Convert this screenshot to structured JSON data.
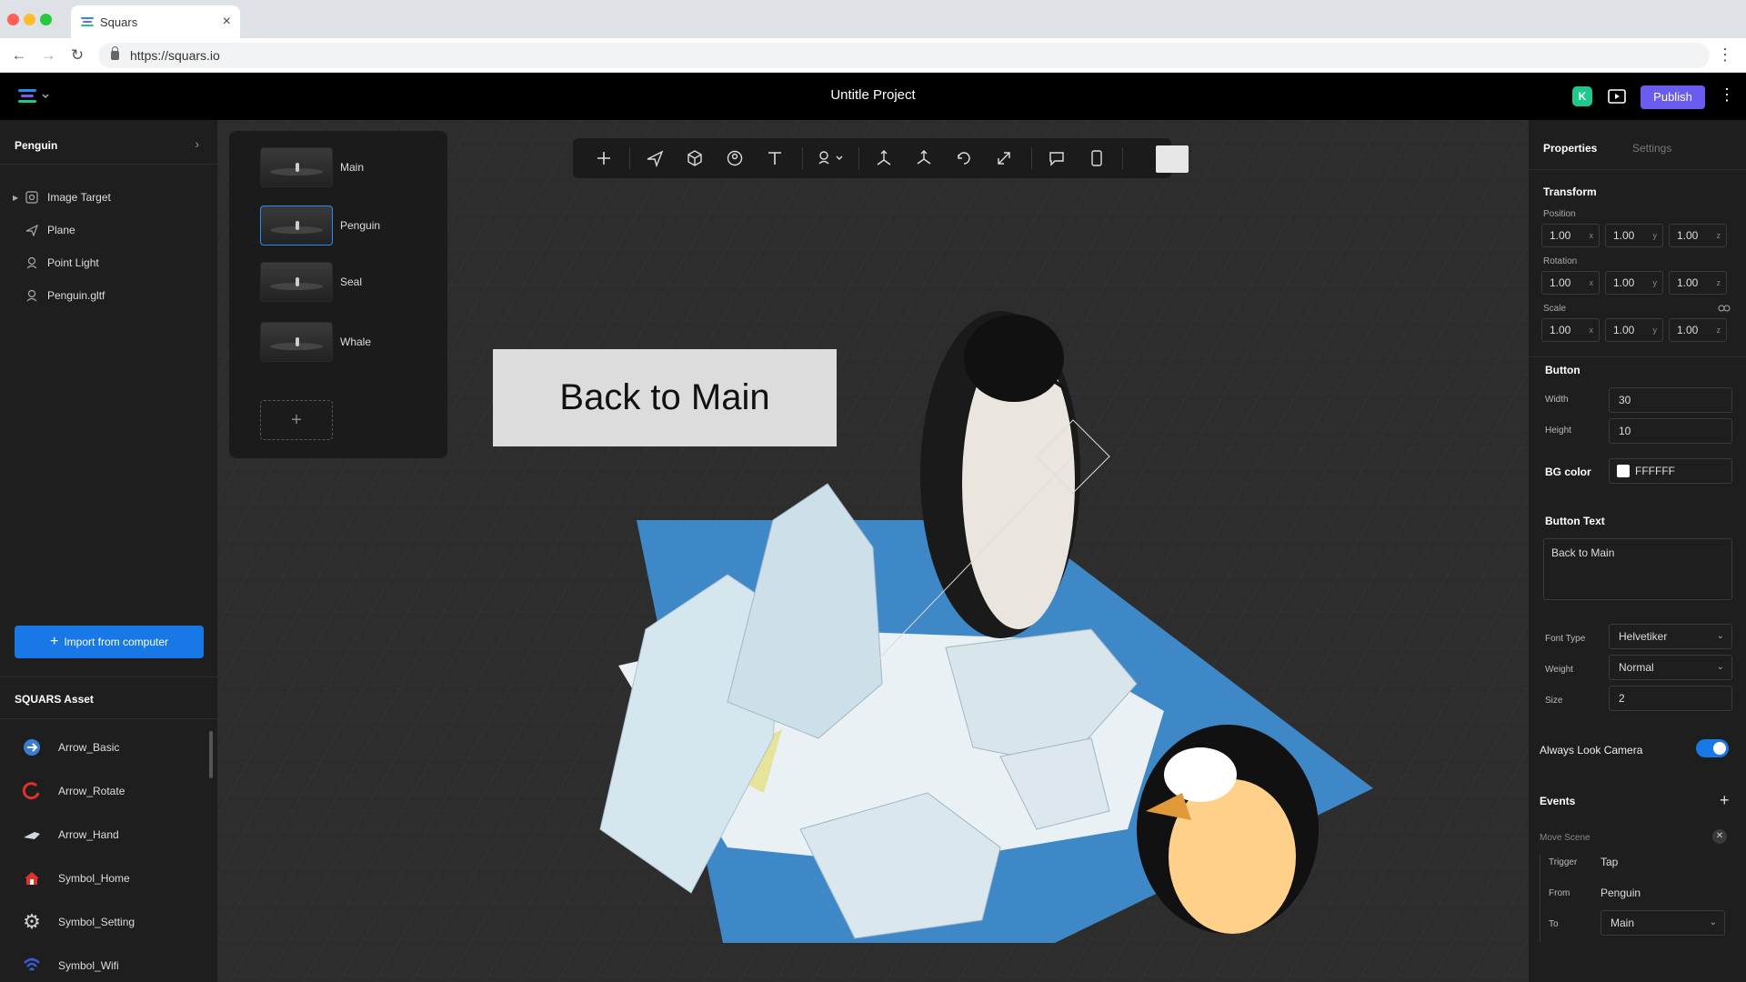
{
  "browser": {
    "tab_title": "Squars",
    "url": "https://squars.io"
  },
  "app": {
    "project_title": "Untitle Project",
    "avatar_letter": "K",
    "publish_label": "Publish"
  },
  "hierarchy": {
    "title": "Penguin",
    "items": [
      {
        "label": "Image Target",
        "icon": "image-target-icon"
      },
      {
        "label": "Plane",
        "icon": "plane-icon"
      },
      {
        "label": "Point Light",
        "icon": "light-icon"
      },
      {
        "label": "Penguin.gltf",
        "icon": "model-icon"
      }
    ],
    "import_label": "Import from computer"
  },
  "assets": {
    "title": "SQUARS Asset",
    "items": [
      {
        "label": "Arrow_Basic",
        "icon": "arrow-basic-icon",
        "color": "#3a7bd5"
      },
      {
        "label": "Arrow_Rotate",
        "icon": "arrow-rotate-icon",
        "color": "#e0312b"
      },
      {
        "label": "Arrow_Hand",
        "icon": "arrow-hand-icon",
        "color": "#cfd8e0"
      },
      {
        "label": "Symbol_Home",
        "icon": "home-icon",
        "color": "#e0312b"
      },
      {
        "label": "Symbol_Setting",
        "icon": "gear-icon",
        "color": "#cfcfcf"
      },
      {
        "label": "Symbol_Wifi",
        "icon": "wifi-icon",
        "color": "#3a5bd5"
      }
    ]
  },
  "scenes": {
    "items": [
      {
        "label": "Main"
      },
      {
        "label": "Penguin"
      },
      {
        "label": "Seal"
      },
      {
        "label": "Whale"
      }
    ],
    "selected": "Penguin"
  },
  "viewport": {
    "button_text": "Back to Main"
  },
  "properties": {
    "tabs": [
      "Properties",
      "Settings"
    ],
    "transform_title": "Transform",
    "position_label": "Position",
    "rotation_label": "Rotation",
    "scale_label": "Scale",
    "position": [
      "1.00",
      "1.00",
      "1.00"
    ],
    "rotation": [
      "1.00",
      "1.00",
      "1.00"
    ],
    "scale": [
      "1.00",
      "1.00",
      "1.00"
    ],
    "axes": [
      "x",
      "y",
      "z"
    ],
    "button_title": "Button",
    "width_label": "Width",
    "width": "30",
    "height_label": "Height",
    "height": "10",
    "bg_color_label": "BG color",
    "bg_color": "FFFFFF",
    "button_text_label": "Button Text",
    "button_text": "Back to Main",
    "font_type_label": "Font Type",
    "font_type": "Helvetiker",
    "weight_label": "Weight",
    "weight": "Normal",
    "size_label": "Size",
    "size": "2",
    "always_look_label": "Always Look Camera",
    "always_look": true,
    "events_title": "Events",
    "event_name": "Move Scene",
    "trigger_label": "Trigger",
    "trigger": "Tap",
    "from_label": "From",
    "from": "Penguin",
    "to_label": "To",
    "to": "Main"
  },
  "colors": {
    "accent": "#1778e6",
    "publish": "#6b5cf0",
    "avatar": "#1ec98d"
  }
}
